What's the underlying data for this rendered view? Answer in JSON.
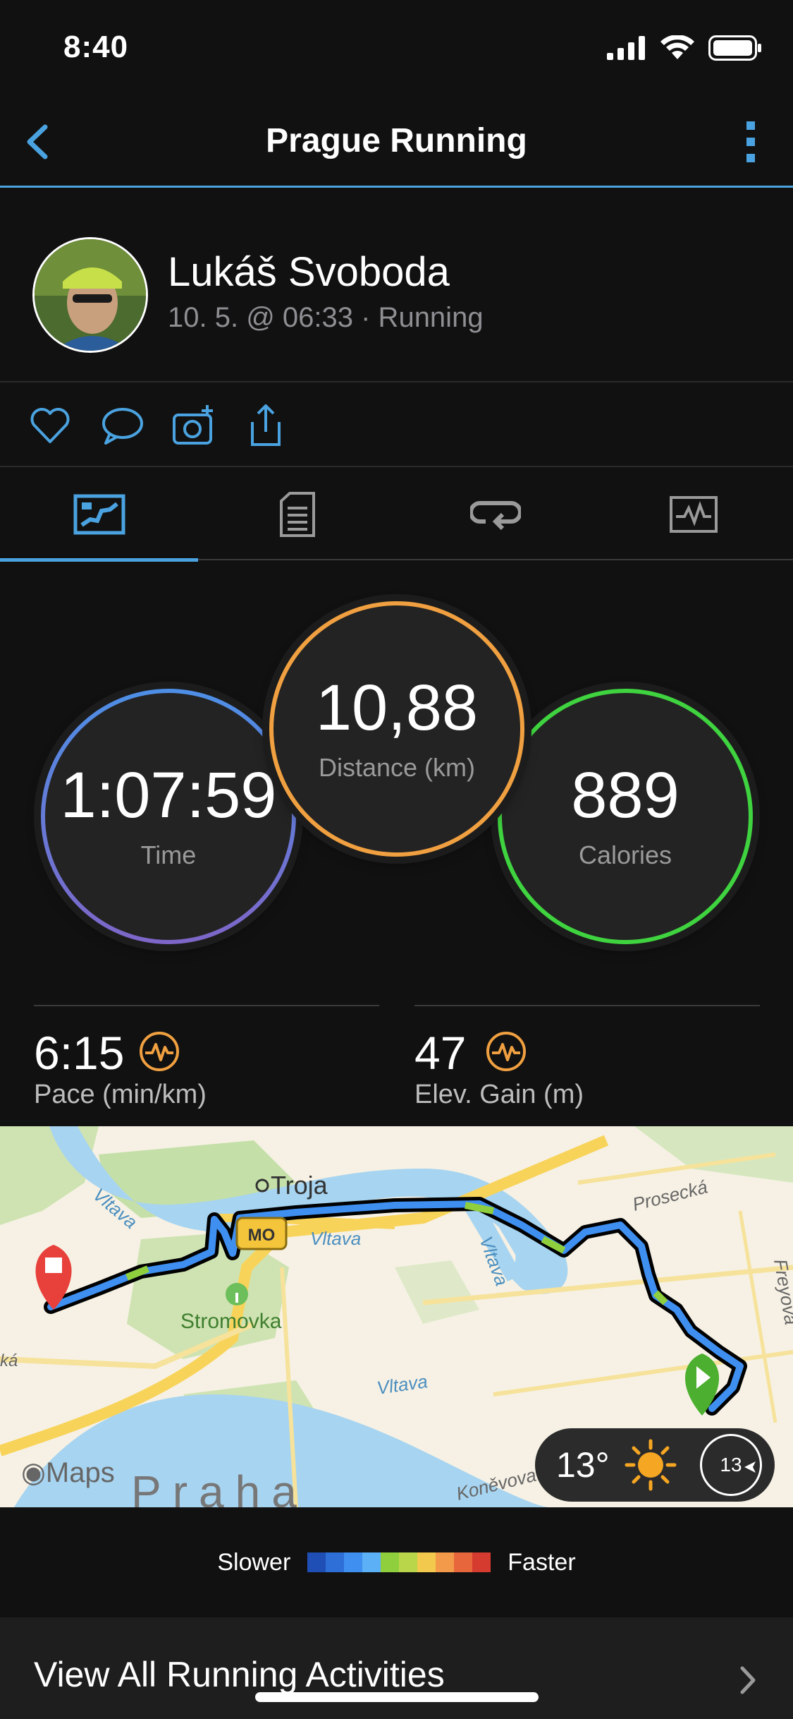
{
  "status_bar": {
    "time": "8:40"
  },
  "nav": {
    "title": "Prague Running"
  },
  "profile": {
    "name": "Lukáš Svoboda",
    "meta": "10. 5. @ 06:33 · Running"
  },
  "actions": [
    "heart-icon",
    "comment-icon",
    "camera-add-icon",
    "share-icon"
  ],
  "tabs": [
    {
      "id": "overview",
      "icon": "map-stats-icon",
      "active": true
    },
    {
      "id": "details",
      "icon": "document-icon",
      "active": false
    },
    {
      "id": "laps",
      "icon": "laps-icon",
      "active": false
    },
    {
      "id": "charts",
      "icon": "chart-icon",
      "active": false
    }
  ],
  "stats": {
    "time": {
      "value": "1:07:59",
      "label": "Time"
    },
    "distance": {
      "value": "10,88",
      "label": "Distance (km)"
    },
    "calories": {
      "value": "889",
      "label": "Calories"
    }
  },
  "metrics": {
    "pace": {
      "value": "6:15",
      "label": "Pace (min/km)"
    },
    "elevation": {
      "value": "47",
      "label": "Elev. Gain (m)"
    }
  },
  "map": {
    "labels": {
      "troja": "Troja",
      "stromovka": "Stromovka",
      "vltava1": "Vltava",
      "vltava2": "Vltava",
      "vltava3": "Vltava",
      "vltava4": "Vltava",
      "prosecka": "Prosecká",
      "freyova": "Freyova",
      "koneva": "Koněvova",
      "praha": "Praha",
      "ka": "ká",
      "mo": "MO"
    },
    "weather": {
      "temp": "13°",
      "wind": "13"
    },
    "attribution": "Maps"
  },
  "legend": {
    "slower": "Slower",
    "faster": "Faster",
    "colors": [
      "#1f4fb5",
      "#2d6fd6",
      "#3f8ff0",
      "#5cb0f5",
      "#8fcf3e",
      "#b9d64a",
      "#f2c94c",
      "#f2994a",
      "#e8663c",
      "#d63b2f"
    ]
  },
  "footer": {
    "view_all": "View All Running Activities"
  },
  "colors": {
    "accent": "#4aa3e0",
    "orange": "#f0a040",
    "green": "#3fd33f",
    "blue": "#4d8fe6"
  }
}
